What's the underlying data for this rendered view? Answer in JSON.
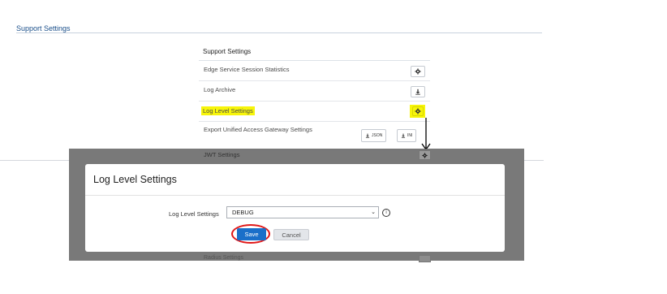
{
  "page": {
    "title": "Support Settings"
  },
  "panel": {
    "header": "Support Settings",
    "rows": [
      {
        "label": "Edge Service Session Statistics",
        "icon": "gear-icon"
      },
      {
        "label": "Log Archive",
        "icon": "download-icon"
      },
      {
        "label": "Log Level Settings",
        "icon": "gear-icon",
        "highlight": "#f7f50a"
      },
      {
        "label": "Export Unified Access Gateway Settings",
        "buttons": [
          "JSON",
          "INI"
        ],
        "icon": "download-icon"
      },
      {
        "label": "JWT Settings",
        "icon": "gear-icon"
      },
      {
        "label": "Radius Settings",
        "icon": "gear-icon"
      }
    ]
  },
  "modal": {
    "title": "Log Level Settings",
    "field_label": "Log Level Settings",
    "selected_value": "DEBUG",
    "save_label": "Save",
    "cancel_label": "Cancel",
    "info_icon": "info-icon"
  },
  "annotations": {
    "highlight_color": "#f7f50a",
    "circle_color": "#e01818",
    "arrow_icon": "arrow-down-icon"
  },
  "colors": {
    "primary": "#1a6fc9",
    "link": "#1a4f8a"
  }
}
